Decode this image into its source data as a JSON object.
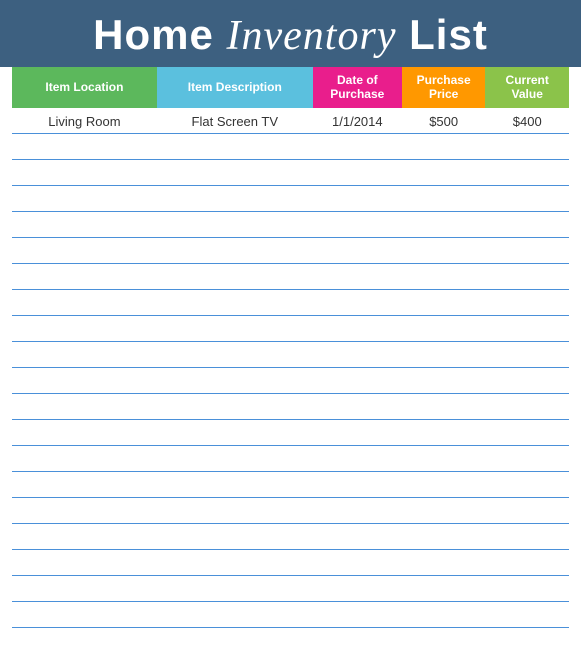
{
  "header": {
    "title_part1": "Home ",
    "title_cursive": "Inventory",
    "title_part2": " List"
  },
  "columns": [
    {
      "id": "location",
      "label": "Item Location",
      "class": "col-location-header"
    },
    {
      "id": "description",
      "label": "Item Description",
      "class": "col-description-header"
    },
    {
      "id": "date",
      "label": "Date of Purchase",
      "class": "col-date-header"
    },
    {
      "id": "purchase_price",
      "label": "Purchase Price",
      "class": "col-purchase-header"
    },
    {
      "id": "current_value",
      "label": "Current Value",
      "class": "col-value-header"
    }
  ],
  "rows": [
    {
      "location": "Living Room",
      "description": "Flat Screen TV",
      "date": "1/1/2014",
      "purchase_price": "$500",
      "current_value": "$400"
    }
  ],
  "empty_row_count": 19
}
